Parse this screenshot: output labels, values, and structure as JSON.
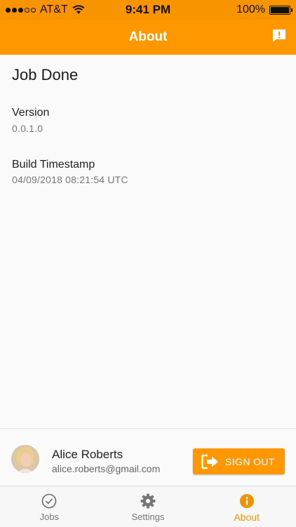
{
  "status_bar": {
    "carrier": "AT&T",
    "time": "9:41 PM",
    "battery": "100%",
    "battery_level": 1.0,
    "signal_bars": 3,
    "signal_total": 5
  },
  "nav": {
    "title": "About",
    "feedback_icon": "feedback-icon"
  },
  "about": {
    "app_name": "Job Done",
    "version_label": "Version",
    "version_value": "0.0.1.0",
    "build_label": "Build Timestamp",
    "build_value": "04/09/2018 08:21:54 UTC"
  },
  "user": {
    "name": "Alice Roberts",
    "email": "alice.roberts@gmail.com",
    "sign_out_label": "SIGN OUT"
  },
  "tabs": [
    {
      "label": "Jobs",
      "icon": "check-circle-icon",
      "active": false
    },
    {
      "label": "Settings",
      "icon": "gear-icon",
      "active": false
    },
    {
      "label": "About",
      "icon": "info-icon",
      "active": true
    }
  ],
  "colors": {
    "accent": "#ff9800",
    "status_bar": "#f79400",
    "active_tab": "#f39200",
    "inactive_tab": "#777777"
  }
}
